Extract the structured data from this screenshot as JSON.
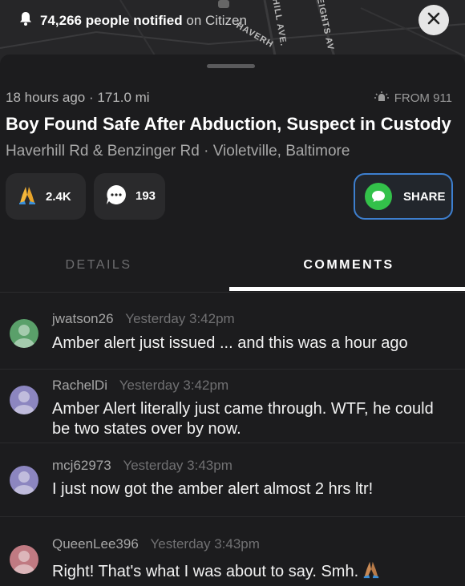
{
  "header": {
    "notified_count": "74,266",
    "notified_bold": "people notified",
    "notified_suffix": "on Citizen",
    "map_labels": [
      "HAVERH",
      "HILL AVE.",
      "EIGHTS AV"
    ]
  },
  "incident": {
    "time_ago": "18 hours ago",
    "distance": "171.0 mi",
    "source": "FROM 911",
    "title": "Boy Found Safe After Abduction, Suspect in Custody",
    "location": "Haverhill Rd & Benzinger Rd · Violetville, Baltimore"
  },
  "actions": {
    "pray_count": "2.4K",
    "comment_count": "193",
    "share_label": "SHARE"
  },
  "tabs": [
    {
      "label": "DETAILS",
      "active": false
    },
    {
      "label": "COMMENTS",
      "active": true
    }
  ],
  "comments": [
    {
      "user": "jwatson26",
      "time": "Yesterday 3:42pm",
      "text": "Amber alert just issued ... and this was a hour ago",
      "avatar_color": "#5aa06a"
    },
    {
      "user": "RachelDi",
      "time": "Yesterday 3:42pm",
      "text": "Amber Alert literally just came through. WTF, he could be two states over by now.",
      "avatar_color": "#8c86c0"
    },
    {
      "user": "mcj62973",
      "time": "Yesterday 3:43pm",
      "text": "I just now got the amber alert almost 2 hrs ltr!",
      "avatar_color": "#8c86c0"
    },
    {
      "user": "QueenLee396",
      "time": "Yesterday 3:43pm",
      "text": "Right! That's what I was about to say. Smh.",
      "avatar_color": "#c07a82"
    }
  ],
  "colors": {
    "background": "#1c1c1e",
    "share_border": "#3d7fcf",
    "share_icon": "#33c14a"
  }
}
